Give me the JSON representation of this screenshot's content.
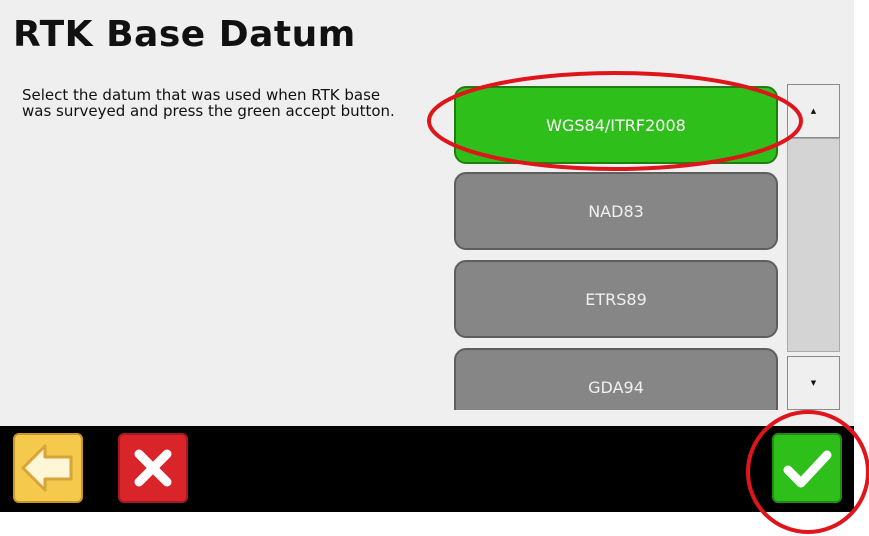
{
  "header": {
    "title": "RTK Base Datum"
  },
  "instructions": "Select the datum that was used when RTK base was surveyed and press the green accept button.",
  "datums": [
    {
      "label": "WGS84/ITRF2008",
      "selected": true
    },
    {
      "label": "NAD83",
      "selected": false
    },
    {
      "label": "ETRS89",
      "selected": false
    },
    {
      "label": "GDA94",
      "selected": false
    }
  ],
  "scrollbar": {
    "up_icon": "arrow-up-icon",
    "down_icon": "arrow-down-icon",
    "up_glyph": "▲",
    "down_glyph": "▼"
  },
  "toolbar": {
    "back_icon": "back-arrow-icon",
    "cancel_icon": "x-icon",
    "accept_icon": "checkmark-icon"
  },
  "colors": {
    "selected_green": "#2fbf1a",
    "unselected_gray": "#868686",
    "annotation_red": "#e0141b",
    "back_yellow": "#f5c94c",
    "cancel_red": "#d9242a"
  }
}
